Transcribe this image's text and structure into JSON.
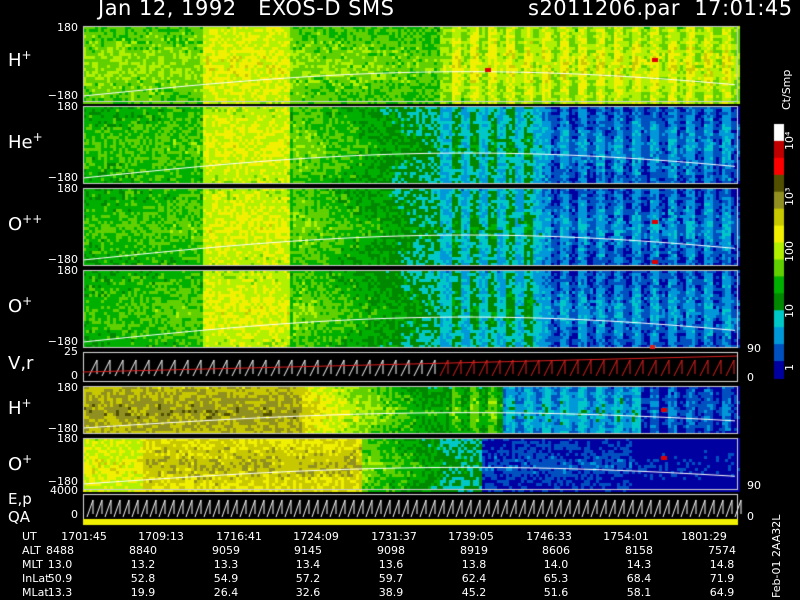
{
  "header": {
    "date_instrument": "Jan 12, 1992   EXOS-D SMS",
    "file_time": "s2011206.par  17:01:45"
  },
  "panels": [
    {
      "species": "H",
      "charge": "+",
      "ymax": "180",
      "ymin": "−180",
      "kind": "spectrogram"
    },
    {
      "species": "He",
      "charge": "+",
      "ymax": "180",
      "ymin": "−180",
      "kind": "spectrogram"
    },
    {
      "species": "O",
      "charge": "++",
      "ymax": "180",
      "ymin": "−180",
      "kind": "spectrogram"
    },
    {
      "species": "O",
      "charge": "+",
      "ymax": "180",
      "ymin": "−180",
      "kind": "spectrogram"
    },
    {
      "species": "V,r",
      "charge": "",
      "ymax": "25",
      "ymin": "0",
      "kind": "line",
      "right_top": "90",
      "right_bottom": "0"
    },
    {
      "species": "H",
      "charge": "+",
      "ymax": "180",
      "ymin": "−180",
      "kind": "spectrogram"
    },
    {
      "species": "O",
      "charge": "+",
      "ymax": "180",
      "ymin": "−180",
      "kind": "spectrogram",
      "right_bottom": "90"
    },
    {
      "species": "E,p",
      "species2": "QA",
      "charge": "",
      "ymax": "4000",
      "ymin": "0",
      "kind": "line",
      "right_bottom": "0"
    }
  ],
  "colorbar": {
    "title": "Ct/Smp",
    "ticks": [
      "10⁴",
      "10³",
      "100",
      "10",
      "1"
    ],
    "colors": [
      "#ffffff",
      "#c00000",
      "#ff0000",
      "#505000",
      "#909020",
      "#c8c800",
      "#f0f000",
      "#b0f000",
      "#60d000",
      "#00b000",
      "#008800",
      "#00c8c8",
      "#0098d8",
      "#0050c0",
      "#0000a0"
    ]
  },
  "chart_data": {
    "type": "heatmap",
    "title": "Jan 12, 1992   EXOS-D SMS",
    "x_label": "UT",
    "tick_rows": [
      {
        "label": "UT",
        "values": [
          "1701:45",
          "1709:13",
          "1716:41",
          "1724:09",
          "1731:37",
          "1739:05",
          "1746:33",
          "1754:01",
          "1801:29"
        ]
      },
      {
        "label": "ALT",
        "values": [
          "8488",
          "8840",
          "9059",
          "9145",
          "9098",
          "8919",
          "8606",
          "8158",
          "7574"
        ]
      },
      {
        "label": "MLT",
        "values": [
          "13.0",
          "13.2",
          "13.3",
          "13.4",
          "13.6",
          "13.8",
          "14.0",
          "14.3",
          "14.8"
        ]
      },
      {
        "label": "InLat",
        "values": [
          "50.9",
          "52.8",
          "54.9",
          "57.2",
          "59.7",
          "62.4",
          "65.3",
          "68.4",
          "71.9"
        ]
      },
      {
        "label": "MLat",
        "values": [
          "13.3",
          "19.9",
          "26.4",
          "32.6",
          "38.9",
          "45.2",
          "51.6",
          "58.1",
          "64.9"
        ]
      }
    ],
    "y_range_pitch_angle": [
      -180,
      180
    ],
    "color_scale": "log",
    "color_range": [
      1,
      10000
    ],
    "side_label": "Feb-01 2AA32L"
  }
}
